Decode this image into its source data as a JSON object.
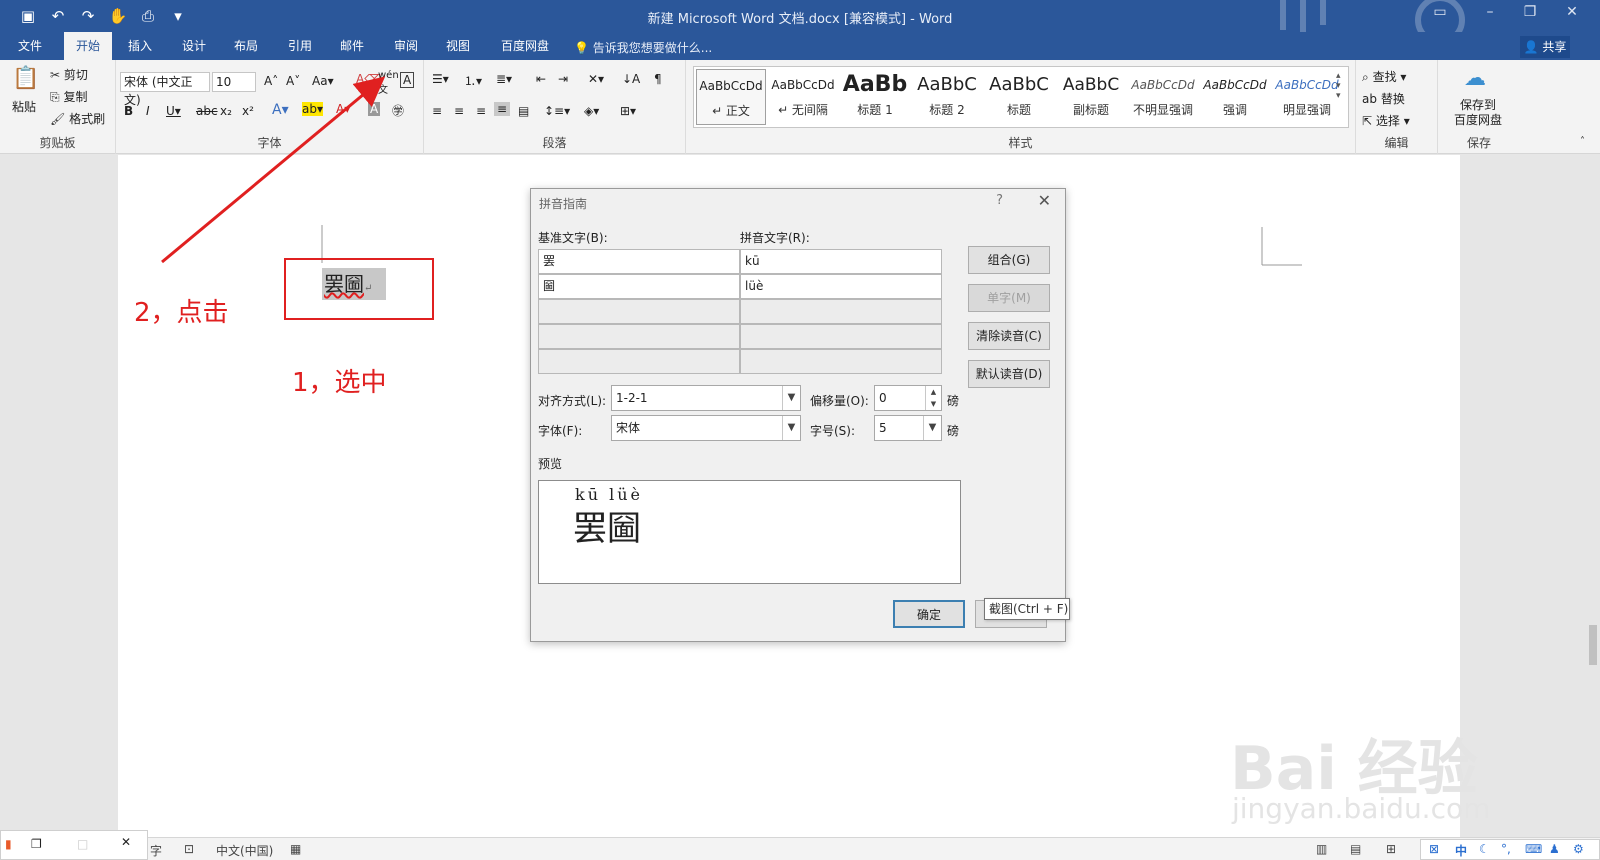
{
  "window": {
    "title": "新建 Microsoft Word 文档.docx [兼容模式] - Word"
  },
  "tabs": [
    "文件",
    "开始",
    "插入",
    "设计",
    "布局",
    "引用",
    "邮件",
    "审阅",
    "视图",
    "百度网盘"
  ],
  "tell_me": "告诉我您想要做什么...",
  "share_label": "共享",
  "ribbon": {
    "clipboard": {
      "paste": "粘贴",
      "cut": "剪切",
      "copy": "复制",
      "format_painter": "格式刷",
      "label": "剪贴板"
    },
    "font": {
      "name": "宋体 (中文正文)",
      "size": "10",
      "label": "字体"
    },
    "paragraph": {
      "label": "段落"
    },
    "styles": {
      "label": "样式",
      "items": [
        {
          "preview": "AaBbCcDd",
          "name": "↵ 正文"
        },
        {
          "preview": "AaBbCcDd",
          "name": "↵ 无间隔"
        },
        {
          "preview": "AaBb",
          "name": "标题 1"
        },
        {
          "preview": "AaBbC",
          "name": "标题 2"
        },
        {
          "preview": "AaBbC",
          "name": "标题"
        },
        {
          "preview": "AaBbC",
          "name": "副标题"
        },
        {
          "preview": "AaBbCcDd",
          "name": "不明显强调"
        },
        {
          "preview": "AaBbCcDd",
          "name": "强调"
        },
        {
          "preview": "AaBbCcDd",
          "name": "明显强调"
        }
      ]
    },
    "editing": {
      "find": "查找",
      "replace": "替换",
      "select": "选择",
      "label": "编辑"
    },
    "save": {
      "line1": "保存到",
      "line2": "百度网盘",
      "label": "保存"
    }
  },
  "document": {
    "selected_text": "罢圙",
    "annotation_select": "1，选中",
    "annotation_click": "2，点击"
  },
  "dialog": {
    "title": "拼音指南",
    "base_label": "基准文字(B):",
    "ruby_label": "拼音文字(R):",
    "rows": [
      {
        "base": "罢",
        "ruby": "kū"
      },
      {
        "base": "圙",
        "ruby": "lüè"
      },
      {
        "base": "",
        "ruby": ""
      },
      {
        "base": "",
        "ruby": ""
      },
      {
        "base": "",
        "ruby": ""
      }
    ],
    "buttons": {
      "group": "组合(G)",
      "mono": "单字(M)",
      "clear": "清除读音(C)",
      "default": "默认读音(D)",
      "ok": "确定"
    },
    "alignment_label": "对齐方式(L):",
    "alignment_value": "1-2-1",
    "offset_label": "偏移量(O):",
    "offset_value": "0",
    "offset_unit": "磅",
    "font_label": "字体(F):",
    "font_value": "宋体",
    "size_label": "字号(S):",
    "size_value": "5",
    "size_unit": "磅",
    "preview_label": "预览",
    "preview_ruby": "kū lüè",
    "preview_base": "罢圙"
  },
  "tooltip": "截图(Ctrl + F)",
  "status": {
    "language": "中文(中国)",
    "word": "字"
  },
  "tray": {
    "ime": "中"
  },
  "watermark": {
    "brand": "Bai 经验",
    "url": "jingyan.baidu.com"
  }
}
